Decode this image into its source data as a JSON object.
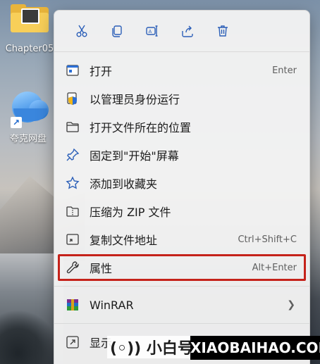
{
  "desktop": {
    "icons": [
      {
        "label": "Chapter05",
        "icon": "folder-icon"
      },
      {
        "label": "夸克网盘",
        "icon": "quark-cloud-icon"
      }
    ]
  },
  "context_menu": {
    "toolbar": [
      {
        "name": "cut-icon"
      },
      {
        "name": "copy-icon"
      },
      {
        "name": "rename-icon"
      },
      {
        "name": "share-icon"
      },
      {
        "name": "delete-icon"
      }
    ],
    "items": [
      {
        "label": "打开",
        "shortcut": "Enter",
        "icon": "open-icon"
      },
      {
        "label": "以管理员身份运行",
        "shortcut": "",
        "icon": "shield-icon"
      },
      {
        "label": "打开文件所在的位置",
        "shortcut": "",
        "icon": "folder-open-icon"
      },
      {
        "label": "固定到\"开始\"屏幕",
        "shortcut": "",
        "icon": "pin-icon"
      },
      {
        "label": "添加到收藏夹",
        "shortcut": "",
        "icon": "star-icon"
      },
      {
        "label": "压缩为 ZIP 文件",
        "shortcut": "",
        "icon": "zip-folder-icon"
      },
      {
        "label": "复制文件地址",
        "shortcut": "Ctrl+Shift+C",
        "icon": "copy-path-icon"
      },
      {
        "label": "属性",
        "shortcut": "Alt+Enter",
        "icon": "wrench-icon",
        "highlighted": true
      },
      {
        "label": "WinRAR",
        "shortcut": "",
        "icon": "winrar-icon",
        "submenu": true
      },
      {
        "label": "显示",
        "shortcut": "",
        "icon": "expand-icon"
      }
    ],
    "highlight_color": "#c5221a"
  },
  "watermark": {
    "left": "(◦)) 小白号",
    "right": "XIAOBAIHAO.COM"
  }
}
